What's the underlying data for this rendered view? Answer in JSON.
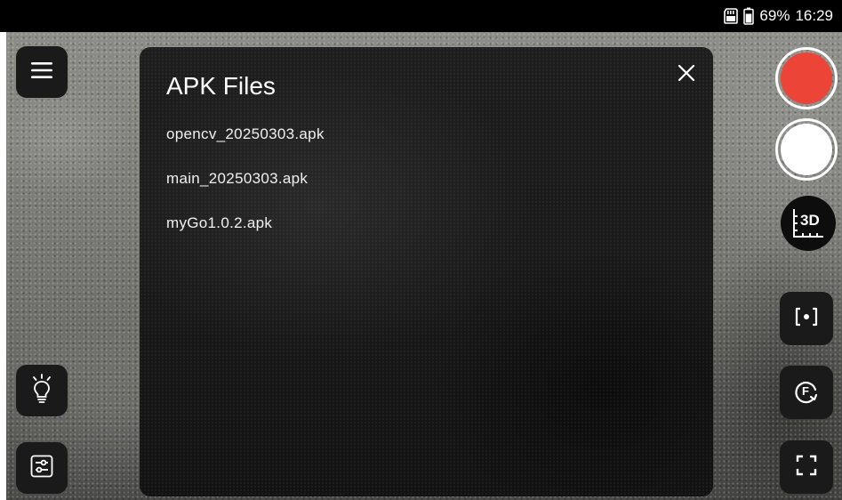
{
  "status_bar": {
    "battery_percent": "69%",
    "time": "16:29",
    "icons": [
      "sd-card-icon",
      "battery-icon"
    ]
  },
  "left_controls": {
    "menu": {
      "icon": "menu-icon"
    },
    "light": {
      "icon": "lightbulb-icon"
    },
    "adjust": {
      "icon": "sliders-icon"
    }
  },
  "right_controls": {
    "record": {
      "icon": "record-icon",
      "color": "#ec4436"
    },
    "shutter": {
      "icon": "shutter-icon",
      "color": "#ffffff"
    },
    "measure_3d": {
      "label": "3D",
      "icon": "ruler-3d-icon"
    },
    "focus": {
      "icon": "focus-frame-icon"
    },
    "flip": {
      "label": "F",
      "icon": "rotate-camera-icon"
    },
    "fullscreen": {
      "icon": "fullscreen-icon"
    }
  },
  "dialog": {
    "title": "APK Files",
    "close_icon": "close-icon",
    "files": [
      {
        "name": "opencv_20250303.apk"
      },
      {
        "name": "main_20250303.apk"
      },
      {
        "name": "myGo1.0.2.apk"
      }
    ]
  }
}
